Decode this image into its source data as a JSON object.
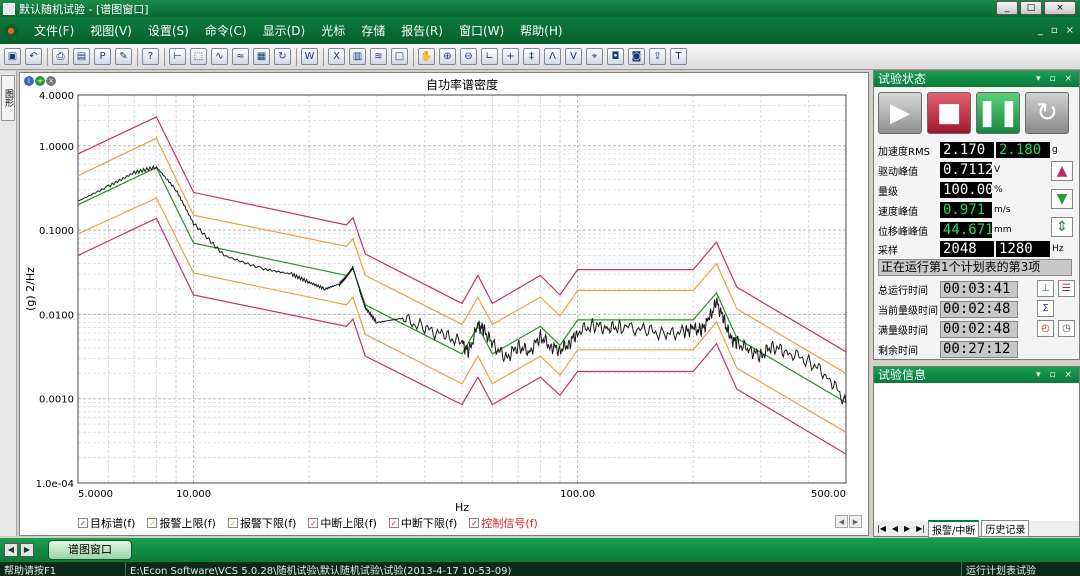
{
  "window": {
    "title": "默认随机试验 - [谱图窗口]",
    "buttons": [
      "_",
      "□",
      "×"
    ]
  },
  "menu": {
    "items": [
      "文件(F)",
      "视图(V)",
      "设置(S)",
      "命令(C)",
      "显示(D)",
      "光标",
      "存储",
      "报告(R)",
      "窗口(W)",
      "帮助(H)"
    ],
    "mdi_buttons": [
      "_",
      "▫",
      "×"
    ]
  },
  "toolbar": {
    "icons": [
      "save-icon",
      "undo-icon",
      "print-icon",
      "print-preview-icon",
      "pdf-icon",
      "tool-icon",
      "help-icon",
      "cursor-icon",
      "zoom-area-icon",
      "wave-icon",
      "signal-icon",
      "table-icon",
      "refresh-icon",
      "word-icon",
      "excel-icon",
      "layout-icon",
      "spectrum-icon",
      "window-icon",
      "hand-icon",
      "zoom-in-icon",
      "zoom-out-icon",
      "axis-icon",
      "crosshair-icon",
      "double-cursor-icon",
      "peak-icon",
      "valley-icon",
      "marker-icon",
      "annotate-icon",
      "annotate-remove-icon",
      "export-icon",
      "text-icon"
    ]
  },
  "sidetab": {
    "label": "图形"
  },
  "chart_data": {
    "type": "line",
    "title": "自功率谱密度",
    "xlabel": "Hz",
    "ylabel": "(g) 2/Hz",
    "xscale": "log",
    "yscale": "log",
    "xlim": [
      5,
      500
    ],
    "ylim": [
      0.0001,
      4
    ],
    "x_ticks": [
      "5.0000",
      "10.000",
      "100.00",
      "500.00"
    ],
    "y_ticks": [
      "1.0e-04",
      "0.0010",
      "0.0100",
      "0.1000",
      "1.0000",
      "4.0000"
    ],
    "grid": true,
    "legend_position": "bottom",
    "series": [
      {
        "name": "目标谱(f)",
        "color": "#2e8b2e",
        "x": [
          5,
          8,
          10,
          25,
          26,
          28,
          50,
          55,
          60,
          80,
          90,
          100,
          200,
          230,
          260,
          500
        ],
        "y": [
          0.2,
          0.55,
          0.07,
          0.029,
          0.035,
          0.013,
          0.0034,
          0.0072,
          0.0034,
          0.0072,
          0.0043,
          0.0086,
          0.0086,
          0.018,
          0.0052,
          0.0009
        ]
      },
      {
        "name": "报警上限(f)",
        "color": "#f0a040",
        "x": [
          5,
          8,
          10,
          25,
          26,
          28,
          50,
          55,
          60,
          80,
          90,
          100,
          200,
          230,
          260,
          500
        ],
        "y": [
          0.44,
          1.23,
          0.15,
          0.064,
          0.079,
          0.029,
          0.0076,
          0.016,
          0.0076,
          0.016,
          0.0096,
          0.0192,
          0.0192,
          0.04,
          0.0116,
          0.002
        ]
      },
      {
        "name": "报警下限(f)",
        "color": "#f0a040",
        "x": [
          5,
          8,
          10,
          25,
          26,
          28,
          50,
          55,
          60,
          80,
          90,
          100,
          200,
          230,
          260,
          500
        ],
        "y": [
          0.09,
          0.24,
          0.031,
          0.013,
          0.016,
          0.0058,
          0.0015,
          0.0032,
          0.0015,
          0.0032,
          0.0019,
          0.0038,
          0.0038,
          0.0081,
          0.0023,
          0.0004
        ]
      },
      {
        "name": "中断上限(f)",
        "color": "#c83070",
        "x": [
          5,
          8,
          10,
          25,
          26,
          28,
          50,
          55,
          60,
          80,
          90,
          100,
          200,
          230,
          260,
          500
        ],
        "y": [
          0.8,
          2.2,
          0.28,
          0.115,
          0.14,
          0.052,
          0.0135,
          0.029,
          0.0135,
          0.029,
          0.017,
          0.034,
          0.034,
          0.072,
          0.021,
          0.0036
        ]
      },
      {
        "name": "中断下限(f)",
        "color": "#c83070",
        "x": [
          5,
          8,
          10,
          25,
          26,
          28,
          50,
          55,
          60,
          80,
          90,
          100,
          200,
          230,
          260,
          500
        ],
        "y": [
          0.05,
          0.138,
          0.017,
          0.0072,
          0.0088,
          0.0032,
          0.00085,
          0.0018,
          0.00085,
          0.0018,
          0.0011,
          0.0021,
          0.0021,
          0.0045,
          0.0013,
          0.00022
        ]
      },
      {
        "name": "控制信号(f)",
        "color": "#1a1a1a",
        "x": [
          5,
          6,
          7,
          8,
          9,
          10,
          12,
          15,
          18,
          20,
          22,
          24,
          25,
          26,
          27,
          28,
          30,
          35,
          40,
          45,
          50,
          52,
          55,
          57,
          60,
          65,
          70,
          75,
          80,
          85,
          90,
          95,
          100,
          110,
          120,
          130,
          150,
          170,
          190,
          200,
          210,
          220,
          230,
          240,
          250,
          260,
          280,
          300,
          320,
          350,
          400,
          450,
          500
        ],
        "y": [
          0.22,
          0.33,
          0.48,
          0.56,
          0.3,
          0.12,
          0.05,
          0.035,
          0.03,
          0.024,
          0.02,
          0.023,
          0.028,
          0.036,
          0.02,
          0.012,
          0.008,
          0.009,
          0.0068,
          0.0056,
          0.0046,
          0.0035,
          0.0075,
          0.0065,
          0.0045,
          0.003,
          0.0042,
          0.0036,
          0.0055,
          0.0042,
          0.0038,
          0.0045,
          0.0062,
          0.0075,
          0.0068,
          0.0072,
          0.0065,
          0.0058,
          0.0062,
          0.0068,
          0.0064,
          0.0088,
          0.014,
          0.0088,
          0.0052,
          0.0046,
          0.0038,
          0.0032,
          0.0042,
          0.0036,
          0.0028,
          0.0018,
          0.0009
        ]
      }
    ]
  },
  "legend": {
    "items": [
      {
        "label": "目标谱(f)",
        "color": "#2e8b2e"
      },
      {
        "label": "报警上限(f)",
        "color": "#f0a040"
      },
      {
        "label": "报警下限(f)",
        "color": "#f0a040"
      },
      {
        "label": "中断上限(f)",
        "color": "#c83070"
      },
      {
        "label": "中断下限(f)",
        "color": "#c83070"
      },
      {
        "label": "控制信号(f)",
        "color": "#e02020"
      }
    ]
  },
  "test_status": {
    "title": "试验状态",
    "accel_rms_label": "加速度RMS",
    "accel_rms_target": "2.170",
    "accel_rms_actual": "2.180",
    "accel_rms_unit": "g",
    "drive_peak_label": "驱动峰值",
    "drive_peak_value": "0.7112",
    "drive_peak_unit": "V",
    "level_label": "量级",
    "level_value": "100.00",
    "level_unit": "%",
    "velocity_label": "速度峰值",
    "velocity_value": "0.971",
    "velocity_unit": "m/s",
    "disp_label": "位移峰峰值",
    "disp_value": "44.671",
    "disp_unit": "mm",
    "sample_label": "采样",
    "sample_a": "2048",
    "sample_b": "1280",
    "sample_unit": "Hz",
    "status_message": "正在运行第1个计划表的第3项",
    "total_time_label": "总运行时间",
    "total_time": "00:03:41",
    "current_level_time_label": "当前量级时间",
    "current_level_time": "00:02:48",
    "full_level_time_label": "满量级时间",
    "full_level_time": "00:02:48",
    "remaining_label": "剩余时间",
    "remaining_time": "00:27:12"
  },
  "test_info": {
    "title": "试验信息",
    "tabs": [
      "报警/中断",
      "历史记录"
    ]
  },
  "bottom": {
    "window_tab": "谱图窗口"
  },
  "statusbar": {
    "help": "帮助请按F1",
    "path": "E:\\Econ Software\\VCS 5.0.28\\随机试验\\默认随机试验\\试验(2013-4-17 10-53-09)",
    "mode": "运行计划表试验"
  }
}
